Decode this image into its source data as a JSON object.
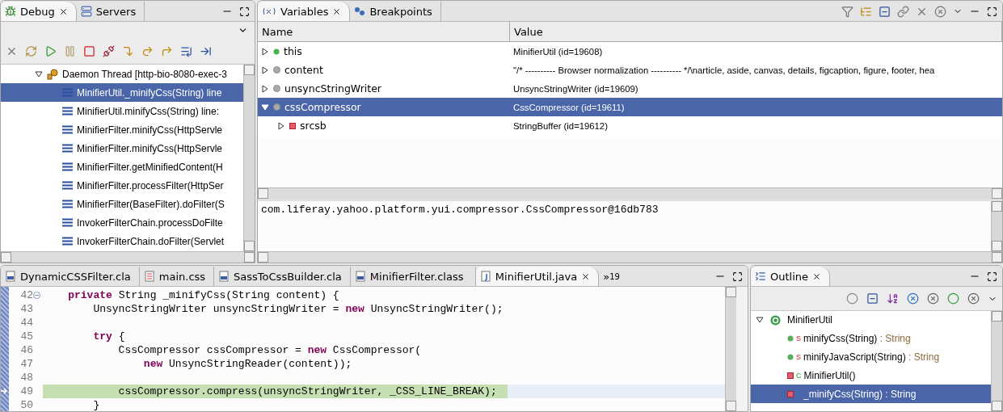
{
  "debug_view": {
    "tabs": [
      {
        "label": "Debug",
        "selected": true,
        "kind": "debug"
      },
      {
        "label": "Servers",
        "selected": false,
        "kind": "servers"
      }
    ],
    "thread": {
      "label": "Daemon Thread [http-bio-8080-exec-3",
      "expanded": true
    },
    "frames": [
      {
        "label": "MinifierUtil._minifyCss(String) line",
        "selected": true
      },
      {
        "label": "MinifierUtil.minifyCss(String) line:",
        "selected": false
      },
      {
        "label": "MinifierFilter.minifyCss(HttpServle",
        "selected": false
      },
      {
        "label": "MinifierFilter.minifyCss(HttpServle",
        "selected": false
      },
      {
        "label": "MinifierFilter.getMinifiedContent(H",
        "selected": false
      },
      {
        "label": "MinifierFilter.processFilter(HttpSer",
        "selected": false
      },
      {
        "label": "MinifierFilter(BaseFilter).doFilter(S",
        "selected": false
      },
      {
        "label": "InvokerFilterChain.processDoFilte",
        "selected": false
      },
      {
        "label": "InvokerFilterChain.doFilter(Servlet",
        "selected": false
      }
    ]
  },
  "variables_view": {
    "tabs": [
      {
        "label": "Variables",
        "selected": true,
        "kind": "variables"
      },
      {
        "label": "Breakpoints",
        "selected": false,
        "kind": "breakpoints"
      }
    ],
    "columns": [
      "Name",
      "Value"
    ],
    "rows": [
      {
        "name": "this",
        "value": "MinifierUtil  (id=19608)",
        "kind": "this",
        "expanded": false,
        "selected": false
      },
      {
        "name": "content",
        "value": "\"/* ---------- Browser normalization ---------- */\\narticle, aside, canvas, details, figcaption, figure, footer, hea",
        "kind": "local",
        "expanded": false,
        "selected": false
      },
      {
        "name": "unsyncStringWriter",
        "value": "UnsyncStringWriter  (id=19609)",
        "kind": "local",
        "expanded": false,
        "selected": false
      },
      {
        "name": "cssCompressor",
        "value": "CssCompressor  (id=19611)",
        "kind": "local",
        "expanded": true,
        "selected": true,
        "children": [
          {
            "name": "srcsb",
            "value": "StringBuffer  (id=19612)",
            "kind": "field",
            "expanded": false,
            "selected": false
          }
        ]
      }
    ],
    "detail": "com.liferay.yahoo.platform.yui.compressor.CssCompressor@16db783"
  },
  "editor": {
    "tabs": [
      {
        "label": "DynamicCSSFilter.cla",
        "kind": "class",
        "selected": false
      },
      {
        "label": "main.css",
        "kind": "css",
        "selected": false
      },
      {
        "label": "SassToCssBuilder.cla",
        "kind": "class",
        "selected": false
      },
      {
        "label": "MinifierFilter.class",
        "kind": "class",
        "selected": false
      },
      {
        "label": "MinifierUtil.java",
        "kind": "java",
        "selected": true
      }
    ],
    "overflow": {
      "mark": "»",
      "count": "19"
    },
    "lines": [
      {
        "number": "42",
        "code": "    **private** String _minifyCss(String content) {",
        "folded": false,
        "current": false
      },
      {
        "number": "43",
        "code": "        UnsyncStringWriter unsyncStringWriter = **new** UnsyncStringWriter();",
        "current": false
      },
      {
        "number": "44",
        "current": false
      },
      {
        "number": "45",
        "code": "        **try** {",
        "current": false
      },
      {
        "number": "46",
        "code": "            CssCompressor cssCompressor = **new** CssCompressor(",
        "current": false
      },
      {
        "number": "47",
        "code": "                **new** UnsyncStringReader(content));",
        "current": false
      },
      {
        "number": "48",
        "current": false
      },
      {
        "number": "49",
        "code": "            cssCompressor.compress(unsyncStringWriter, _CSS_LINE_BREAK);",
        "current": true
      },
      {
        "number": "50",
        "code": "        }",
        "current": false
      }
    ]
  },
  "outline_view": {
    "tab": "Outline",
    "root": {
      "name": "MinifierUtil",
      "expanded": true,
      "children": [
        {
          "name": "minifyCss(String)",
          "type": " : String",
          "modifier": "S",
          "kind": "public",
          "selected": false
        },
        {
          "name": "minifyJavaScript(String)",
          "type": " : String",
          "modifier": "S",
          "kind": "public",
          "selected": false
        },
        {
          "name": "MinifierUtil()",
          "modifier": "C",
          "kind": "private",
          "selected": false
        },
        {
          "name": "_minifyCss(String)",
          "type": " : String",
          "kind": "private",
          "selected": true
        }
      ]
    }
  }
}
